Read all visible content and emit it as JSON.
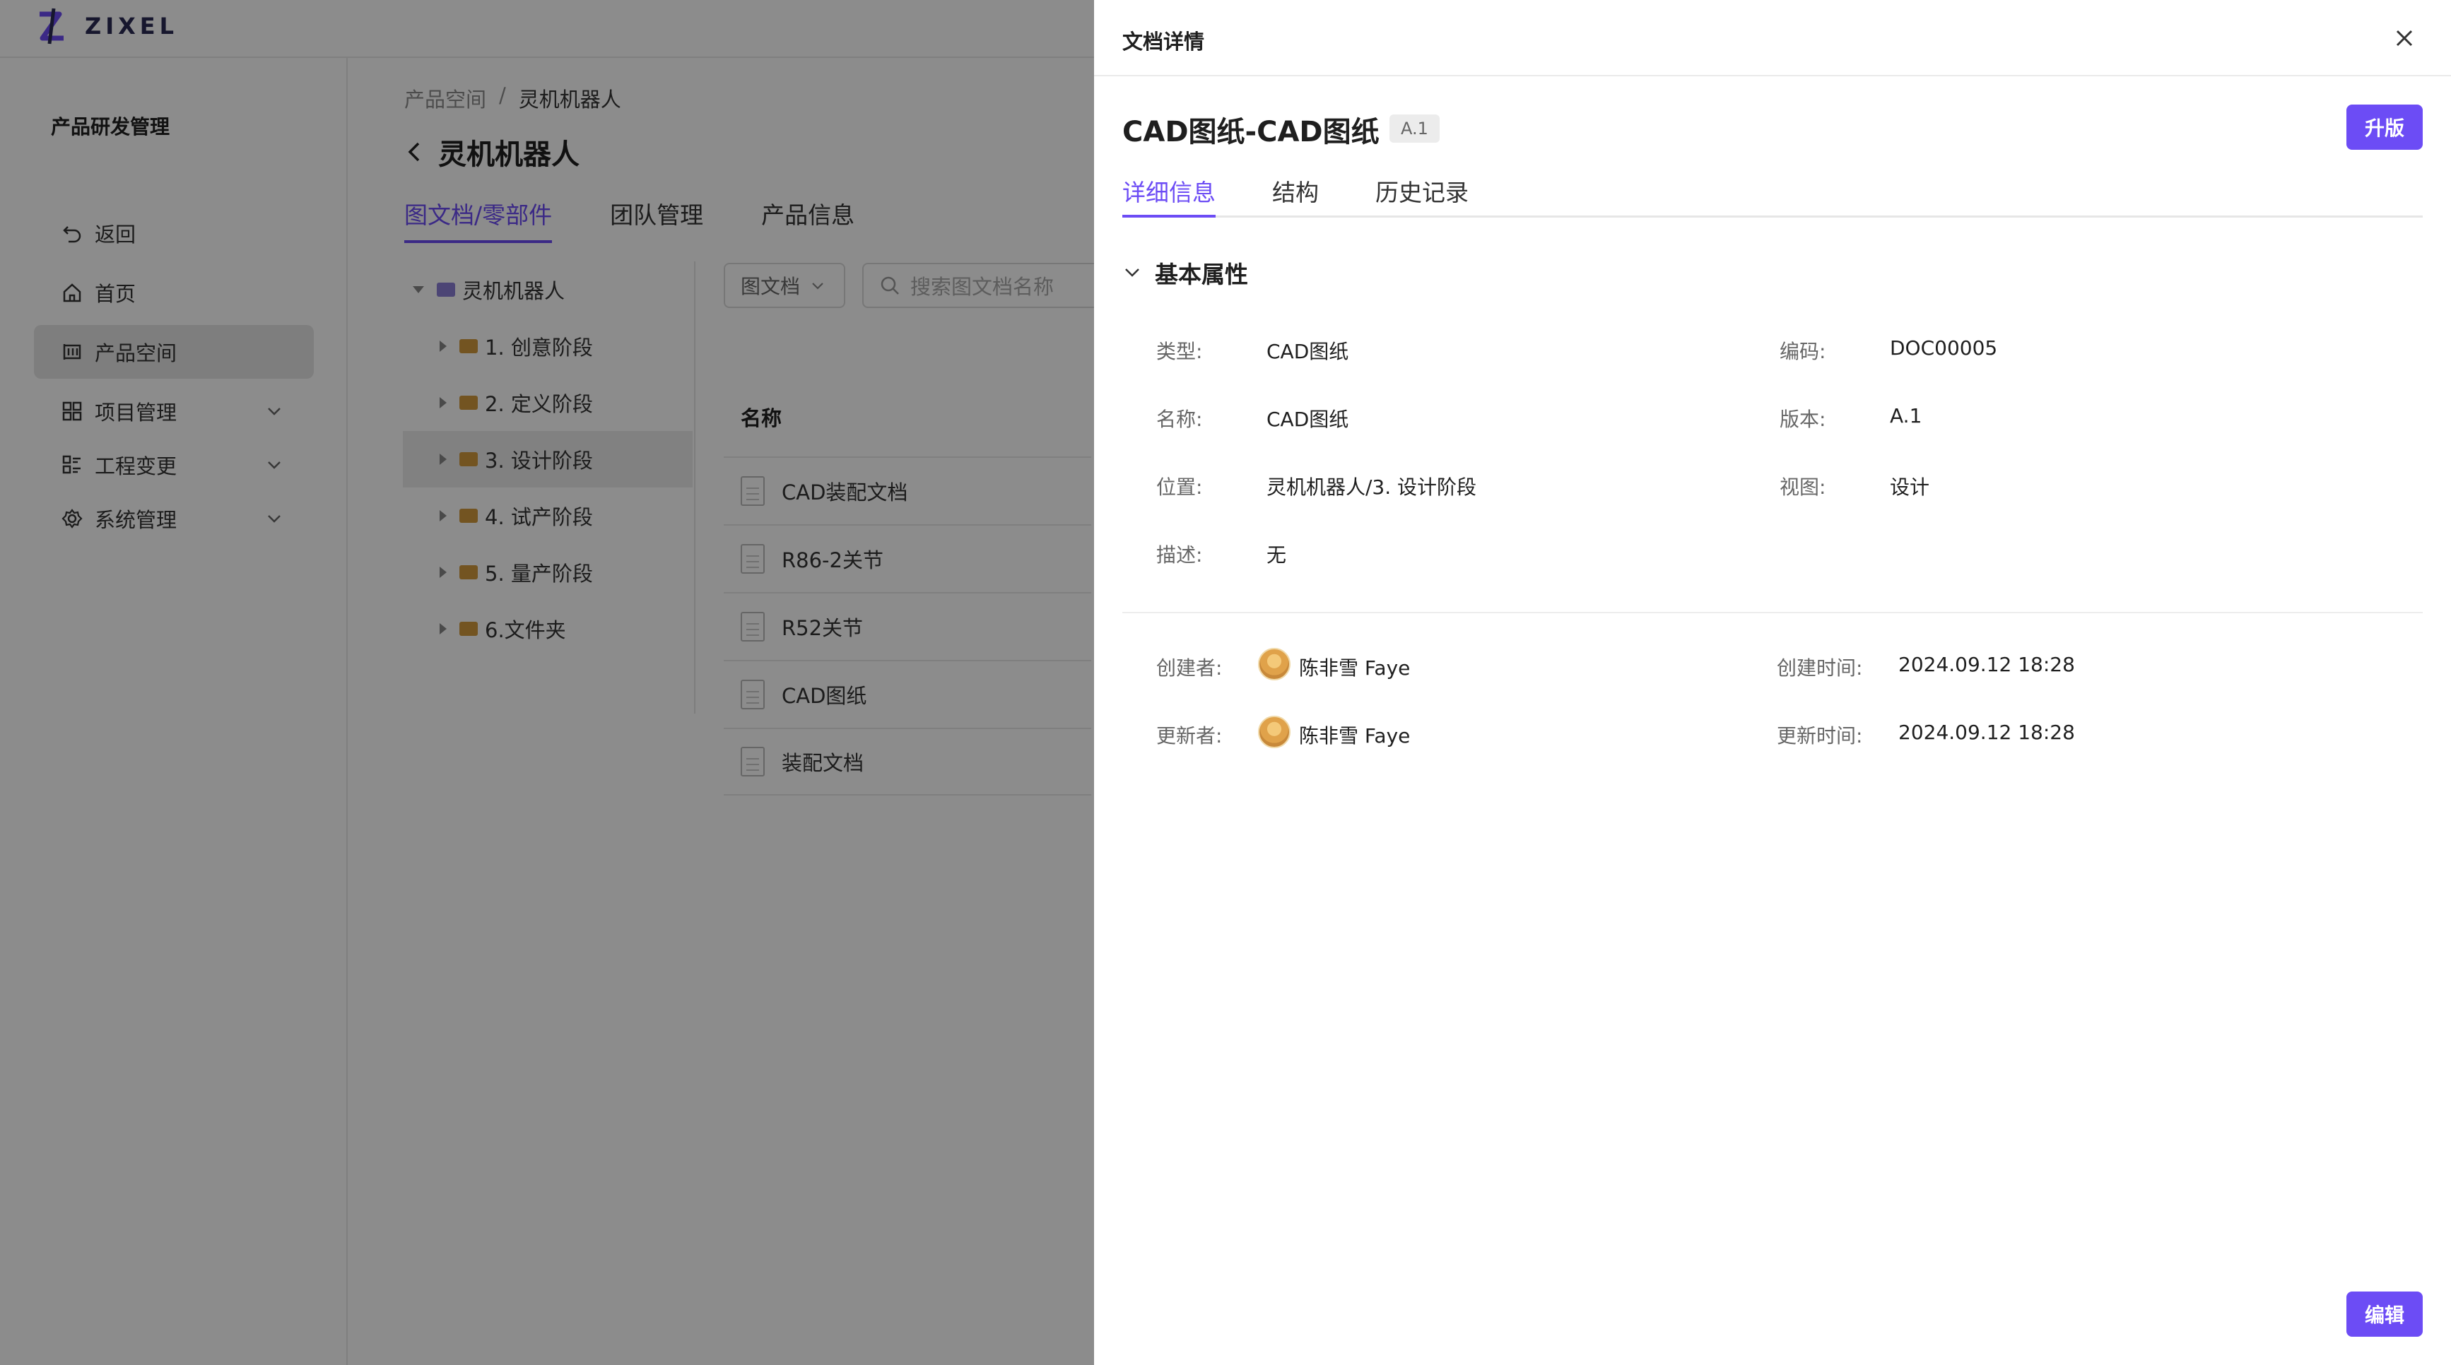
{
  "app": {
    "logo_text": "ZIXEL"
  },
  "sidebar": {
    "title": "产品研发管理",
    "items": [
      {
        "label": "返回",
        "icon": "undo-icon"
      },
      {
        "label": "首页",
        "icon": "home-icon"
      },
      {
        "label": "产品空间",
        "icon": "product-space-icon",
        "active": true
      },
      {
        "label": "项目管理",
        "icon": "grid-icon",
        "expandable": true
      },
      {
        "label": "工程变更",
        "icon": "list-icon",
        "expandable": true
      },
      {
        "label": "系统管理",
        "icon": "gear-icon",
        "expandable": true
      }
    ]
  },
  "main": {
    "breadcrumb": [
      "产品空间",
      "灵机机器人"
    ],
    "breadcrumb_sep": "/",
    "title": "灵机机器人",
    "tabs": [
      "图文档/零部件",
      "团队管理",
      "产品信息"
    ],
    "tree": {
      "root": "灵机机器人",
      "children": [
        "1. 创意阶段",
        "2. 定义阶段",
        "3. 设计阶段",
        "4. 试产阶段",
        "5. 量产阶段",
        "6.文件夹"
      ]
    },
    "filter_label": "图文档",
    "search_placeholder": "搜索图文档名称",
    "table_header": "名称",
    "rows": [
      "CAD装配文档",
      "R86-2关节",
      "R52关节",
      "CAD图纸",
      "装配文档"
    ]
  },
  "drawer": {
    "title": "文档详情",
    "doc_title": "CAD图纸-CAD图纸",
    "version_badge": "A.1",
    "upgrade_label": "升版",
    "edit_label": "编辑",
    "tabs": [
      "详细信息",
      "结构",
      "历史记录"
    ],
    "section_title": "基本属性",
    "props": {
      "type_label": "类型:",
      "type_value": "CAD图纸",
      "code_label": "编码:",
      "code_value": "DOC00005",
      "name_label": "名称:",
      "name_value": "CAD图纸",
      "version_label": "版本:",
      "version_value": "A.1",
      "location_label": "位置:",
      "location_value": "灵机机器人/3. 设计阶段",
      "view_label": "视图:",
      "view_value": "设计",
      "desc_label": "描述:",
      "desc_value": "无"
    },
    "meta": {
      "creator_label": "创建者:",
      "creator": "陈非雪 Faye",
      "created_label": "创建时间:",
      "created": "2024.09.12 18:28",
      "updater_label": "更新者:",
      "updater": "陈非雪 Faye",
      "updated_label": "更新时间:",
      "updated": "2024.09.12 18:28"
    }
  },
  "colors": {
    "accent": "#6c4cf5",
    "mask": "rgba(0,0,0,0.45)"
  }
}
